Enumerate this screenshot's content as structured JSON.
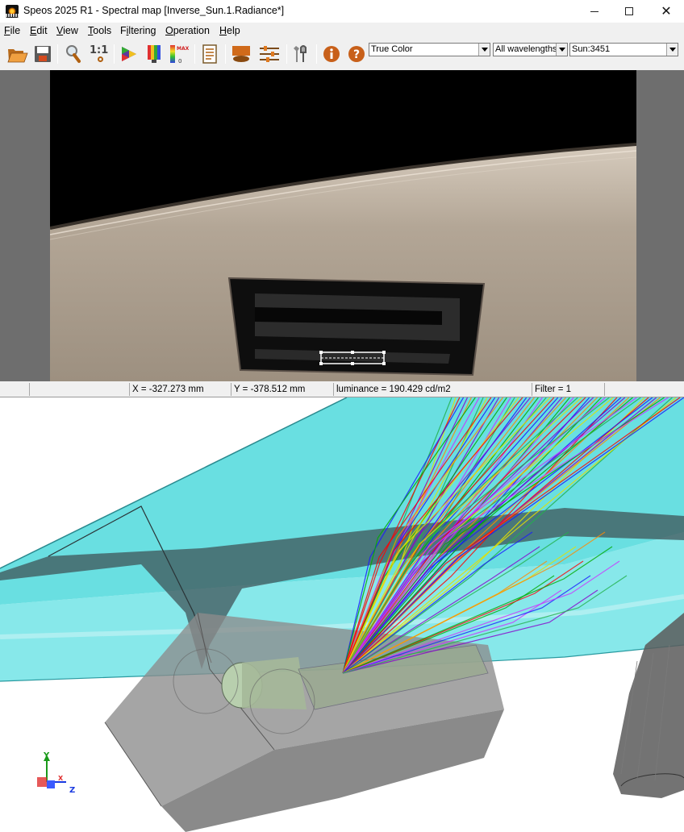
{
  "window": {
    "title": "Speos 2025 R1 - Spectral map [Inverse_Sun.1.Radiance*]",
    "controls": {
      "minimize": "─",
      "maximize": "☐",
      "close": "✕"
    }
  },
  "menu": {
    "items": [
      {
        "acc": "F",
        "rest": "ile"
      },
      {
        "acc": "E",
        "rest": "dit"
      },
      {
        "acc": "V",
        "rest": "iew"
      },
      {
        "acc": "T",
        "rest": "ools"
      },
      {
        "acc": "",
        "pre": "F",
        "under": "i",
        "rest": "ltering"
      },
      {
        "acc": "O",
        "rest": "peration"
      },
      {
        "acc": "H",
        "rest": "elp"
      }
    ]
  },
  "toolbar": {
    "zoom_label": "1:1",
    "dropdowns": {
      "color_mode": "True Color",
      "wavelength": "All wavelengths",
      "layer": "Sun:3451"
    },
    "icons": [
      "open-folder-icon",
      "save-icon",
      "zoom-icon",
      "actual-size-icon",
      "color-spectrum-icon",
      "false-color-icon",
      "max-scale-icon",
      "report-icon",
      "surface-icon",
      "settings-sliders-icon",
      "tools-icon",
      "info-icon",
      "help-icon"
    ]
  },
  "status": {
    "x": "X = -327.273 mm",
    "y": "Y = -378.512 mm",
    "luminance": "luminance = 190.429 cd/m2",
    "filter": "Filter = 1"
  },
  "triad": {
    "y": "Y",
    "x": "X",
    "z": "Z"
  },
  "colors": {
    "glass": "#4fd9dc",
    "box": "#8a8a8a",
    "ray_colors": [
      "#22b14c",
      "#e4e000",
      "#ff0000",
      "#1a1aff",
      "#8800cc",
      "#ff8800",
      "#00aa00",
      "#cc33ff"
    ]
  }
}
